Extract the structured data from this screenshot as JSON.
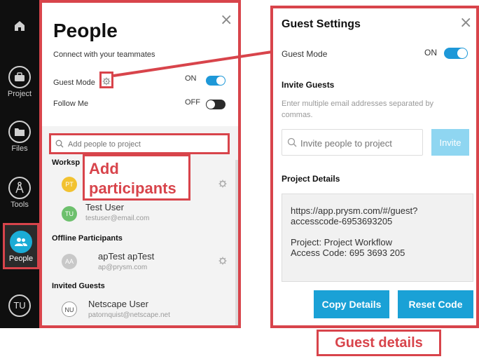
{
  "sidebar": {
    "items": [
      {
        "label": "",
        "icon": "home-icon"
      },
      {
        "label": "Project",
        "icon": "briefcase-icon"
      },
      {
        "label": "Files",
        "icon": "folder-icon"
      },
      {
        "label": "Tools",
        "icon": "compass-icon"
      },
      {
        "label": "People",
        "icon": "people-icon"
      }
    ],
    "user_initials": "TU"
  },
  "people_panel": {
    "title": "People",
    "subtitle": "Connect with your teammates",
    "guest_mode_label": "Guest Mode",
    "guest_mode_state": "ON",
    "follow_me_label": "Follow Me",
    "follow_me_state": "OFF",
    "search_placeholder": "Add people to project",
    "workspace_heading": "Worksp",
    "participants": [
      {
        "initials": "PT",
        "name": "",
        "email": "",
        "color": "#f2c230"
      },
      {
        "initials": "TU",
        "name": "Test User",
        "email": "testuser@email.com",
        "color": "#6dc06d"
      }
    ],
    "offline_heading": "Offline Participants",
    "offline": [
      {
        "initials": "AA",
        "name": "apTest apTest",
        "email": "ap@prysm.com",
        "color": "#c8c8c8"
      }
    ],
    "invited_heading": "Invited Guests",
    "invited": [
      {
        "initials": "NU",
        "name": "Netscape User",
        "email": "patornquist@netscape.net"
      }
    ]
  },
  "annotations": {
    "add_participants": [
      "Add",
      "participants"
    ],
    "guest_details": "Guest details"
  },
  "guest_panel": {
    "title": "Guest Settings",
    "guest_mode_label": "Guest Mode",
    "guest_mode_state": "ON",
    "invite_heading": "Invite Guests",
    "invite_hint": "Enter multiple email addresses separated by commas.",
    "invite_placeholder": "Invite people to project",
    "invite_button": "Invite",
    "details_heading": "Project Details",
    "details_lines": [
      "https://app.prysm.com/#/guest?",
      "accesscode-6953693205",
      "",
      "Project: Project Workflow",
      "Access Code: 695 3693 205"
    ],
    "copy_button": "Copy Details",
    "reset_button": "Reset Code"
  },
  "colors": {
    "accent": "#1aa1d6",
    "annotation_red": "#d8444b",
    "sidebar_bg": "#0f0f0f"
  }
}
